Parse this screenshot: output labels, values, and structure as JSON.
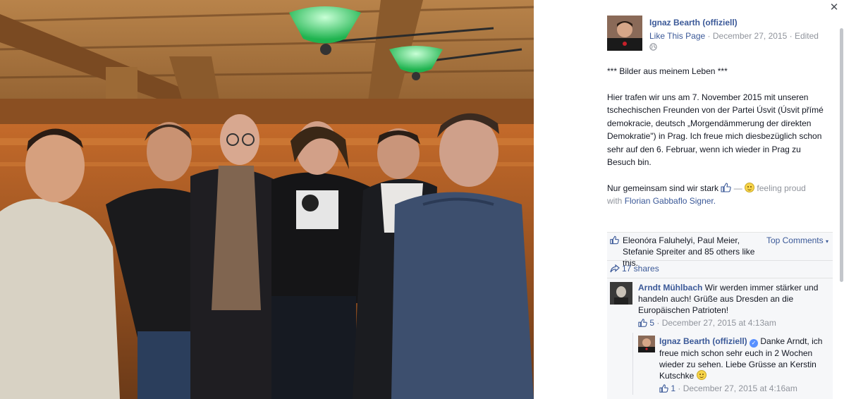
{
  "post": {
    "page_name": "Ignaz Bearth (offiziell)",
    "like_page": "Like This Page",
    "date": "December 27, 2015",
    "edited": "Edited",
    "separator": "·",
    "paragraph1": "*** Bilder aus meinem Leben ***",
    "paragraph2": "Hier trafen wir uns am 7. November 2015 mit unseren tschechischen Freunden von der Partei Úsvit (Úsvit přímé demokracie, deutsch „Morgendämmerung der direkten Demokratie\") in Prag. Ich freue mich diesbezüglich schon sehr auf den 6. Februar, wenn ich wieder in Prag zu Besuch bin.",
    "paragraph3_start": "Nur gemeinsam sind wir stark",
    "dash": "—",
    "feeling": "feeling proud",
    "with_word": "with",
    "tagged": "Florian Gabbaflo Signer."
  },
  "feedback": {
    "likes_text": "Eleonóra Faluhelyi, Paul Meier, Stefanie Spreiter and 85 others like this.",
    "top_comments": "Top Comments",
    "shares": "17 shares"
  },
  "comments": [
    {
      "author": "Arndt Mühlbach",
      "text": "Wir werden immer stärker und handeln auch! Grüße aus Dresden an die Europäischen Patrioten!",
      "likes": "5",
      "time": "December 27, 2015 at 4:13am"
    },
    {
      "author": "Ignaz Bearth (offiziell)",
      "text": "Danke Arndt, ich freue mich schon sehr euch in 2 Wochen wieder zu sehen. Liebe Grüsse an Kerstin Kutschke",
      "likes": "1",
      "time": "December 27, 2015 at 4:16am"
    }
  ],
  "icons": {
    "close": "close-icon",
    "globe": "globe-icon",
    "like": "thumbs-up-icon",
    "share": "share-icon",
    "emoji": "smiley-icon",
    "verified": "verified-icon"
  },
  "colors": {
    "link": "#3b5998",
    "muted": "#90949c",
    "feedback_bg": "#f6f7f9",
    "lamp_green": "#2ecf62"
  }
}
